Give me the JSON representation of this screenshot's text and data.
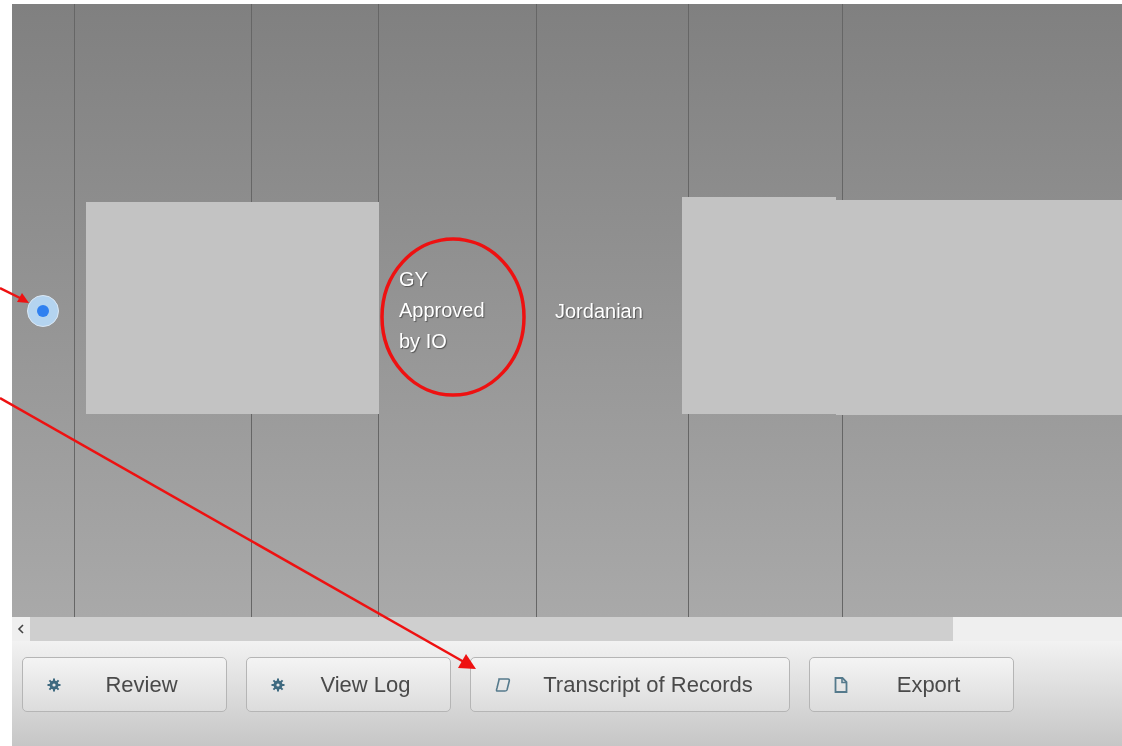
{
  "table": {
    "rows": [
      {
        "selected": true,
        "status": "GY Approved by IO",
        "nationality": "Jordanian"
      }
    ]
  },
  "buttons": [
    {
      "kind": "gear",
      "label": "Review"
    },
    {
      "kind": "gear",
      "label": "View Log"
    },
    {
      "kind": "scroll",
      "label": "Transcript of Records"
    },
    {
      "kind": "document",
      "label": "Export"
    }
  ]
}
